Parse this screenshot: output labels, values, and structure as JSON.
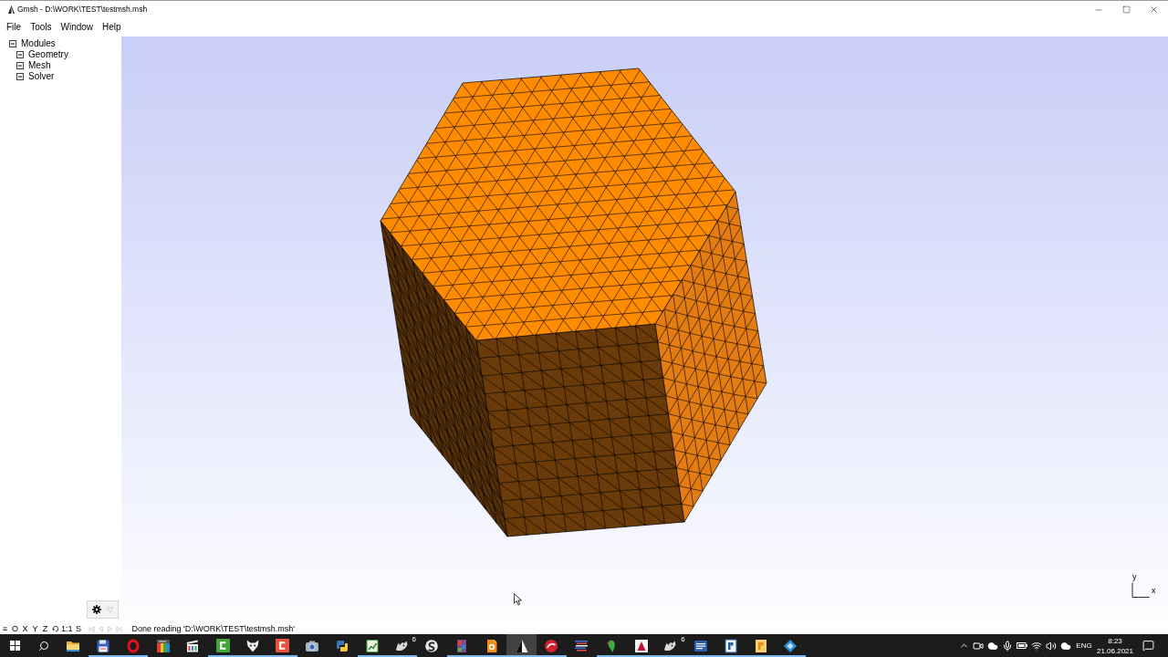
{
  "window": {
    "title": "Gmsh - D:\\WORK\\TEST\\testmsh.msh"
  },
  "menu": [
    "File",
    "Tools",
    "Window",
    "Help"
  ],
  "tree": [
    {
      "label": "Modules",
      "expanded": true,
      "children": [
        {
          "label": "Geometry",
          "expanded": true
        },
        {
          "label": "Mesh",
          "expanded": true
        },
        {
          "label": "Solver",
          "expanded": true
        }
      ]
    }
  ],
  "graphics": {
    "axis_labels": [
      "y",
      "x"
    ]
  },
  "status_bar": {
    "view_buttons": [
      {
        "kind": "text",
        "label": "≡"
      },
      {
        "kind": "text",
        "label": "O"
      },
      {
        "kind": "text",
        "label": "X"
      },
      {
        "kind": "text",
        "label": "Y"
      },
      {
        "kind": "text",
        "label": "Z"
      },
      {
        "kind": "rotate"
      },
      {
        "kind": "text",
        "label": "1:1"
      },
      {
        "kind": "text",
        "label": "S"
      }
    ],
    "playback_buttons": [
      {
        "kind": "first",
        "disabled": true
      },
      {
        "kind": "previous",
        "disabled": true
      },
      {
        "kind": "next",
        "disabled": true
      },
      {
        "kind": "last",
        "disabled": true
      }
    ],
    "message": "Done reading 'D:\\WORK\\TEST\\testmsh.msh'"
  },
  "taskbar": {
    "apps": [
      {
        "kind": "folder",
        "running": false,
        "selected": false
      },
      {
        "kind": "floppy",
        "running": true,
        "selected": false
      },
      {
        "kind": "ring",
        "running": true,
        "selected": false
      },
      {
        "kind": "gradient",
        "running": false,
        "selected": false
      },
      {
        "kind": "clapper",
        "running": false,
        "selected": false
      },
      {
        "kind": "bracket",
        "color": "#43a63b",
        "running": true,
        "selected": false
      },
      {
        "kind": "fox",
        "running": true,
        "selected": false
      },
      {
        "kind": "bracket",
        "color": "#e8533f",
        "running": true,
        "selected": false
      },
      {
        "kind": "camera",
        "running": false,
        "selected": false
      },
      {
        "kind": "snakes",
        "running": false,
        "selected": false
      },
      {
        "kind": "chart",
        "running": true,
        "selected": false
      },
      {
        "kind": "rhino",
        "badge": "6",
        "running": true,
        "selected": false
      },
      {
        "kind": "swirl",
        "running": false,
        "selected": false
      },
      {
        "kind": "book",
        "running": true,
        "selected": false
      },
      {
        "kind": "sheet",
        "running": true,
        "selected": false
      },
      {
        "kind": "triangle",
        "running": true,
        "selected": true
      },
      {
        "kind": "emblem",
        "running": true,
        "selected": false
      },
      {
        "kind": "stripes",
        "running": false,
        "selected": false
      },
      {
        "kind": "parrot",
        "running": true,
        "selected": false
      },
      {
        "kind": "peak",
        "running": true,
        "selected": false
      },
      {
        "kind": "rhino",
        "badge": "6",
        "running": true,
        "selected": false
      },
      {
        "kind": "doc",
        "running": true,
        "selected": false
      },
      {
        "kind": "block",
        "running": true,
        "selected": false
      },
      {
        "kind": "card",
        "running": true,
        "selected": false
      },
      {
        "kind": "diamond",
        "running": true,
        "selected": false
      }
    ],
    "tray": {
      "language": "ENG",
      "time": "8:23",
      "date": "21.06.2021"
    }
  }
}
